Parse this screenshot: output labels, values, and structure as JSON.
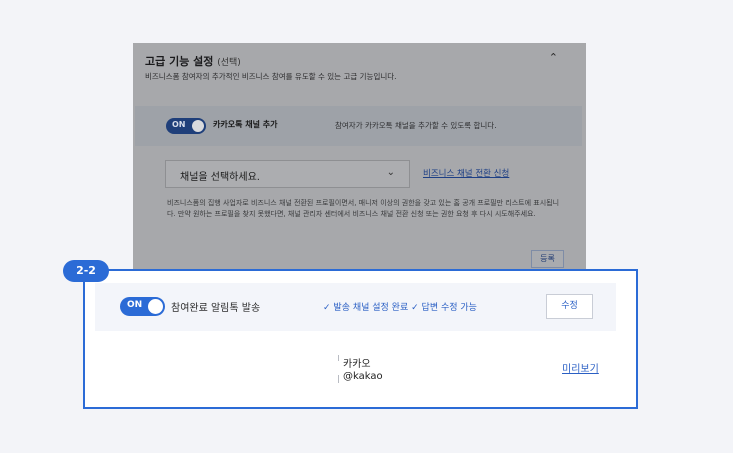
{
  "advanced": {
    "title": "고급 기능 설정",
    "optional": "(선택)",
    "description": "비즈니스폼 참여자의 추가적인 비즈니스 참여를 유도할 수 있는 고급 기능입니다.",
    "chevron_icon": "chevron-up-icon"
  },
  "channel": {
    "toggle_label": "ON",
    "label": "카카오톡 채널 추가",
    "help": "참여자가 카카오톡 채널을 추가할 수 있도록 합니다.",
    "select_value": "채널을 선택하세요.",
    "convert_link": "비즈니스 채널 전환 신청",
    "note": "비즈니스폼의 집행 사업자로 비즈니스 채널 전환된 프로필이면서, 매니저 이상의 권한을 갖고 있는 홈 공개 프로필만 리스트에 표시됩니다. 만약 원하는 프로필을 찾지 못했다면, 채널 관리자 센터에서 비즈니스 채널 전환 신청 또는 권한 요청 후 다시 시도해주세요.",
    "register_button": "등록"
  },
  "badge": "2-2",
  "alimtalk": {
    "toggle_label": "ON",
    "label": "참여완료 알림톡 발송",
    "status_1": "발송 채널 설정 완료",
    "status_2": "답변 수정 가능",
    "check_glyph": "✓",
    "edit_button": "수정"
  },
  "sender": {
    "name": "카카오",
    "id": "@kakao"
  },
  "preview_link": "미리보기",
  "colors": {
    "accent": "#2b6bd6",
    "background": "#f3f4f8"
  }
}
